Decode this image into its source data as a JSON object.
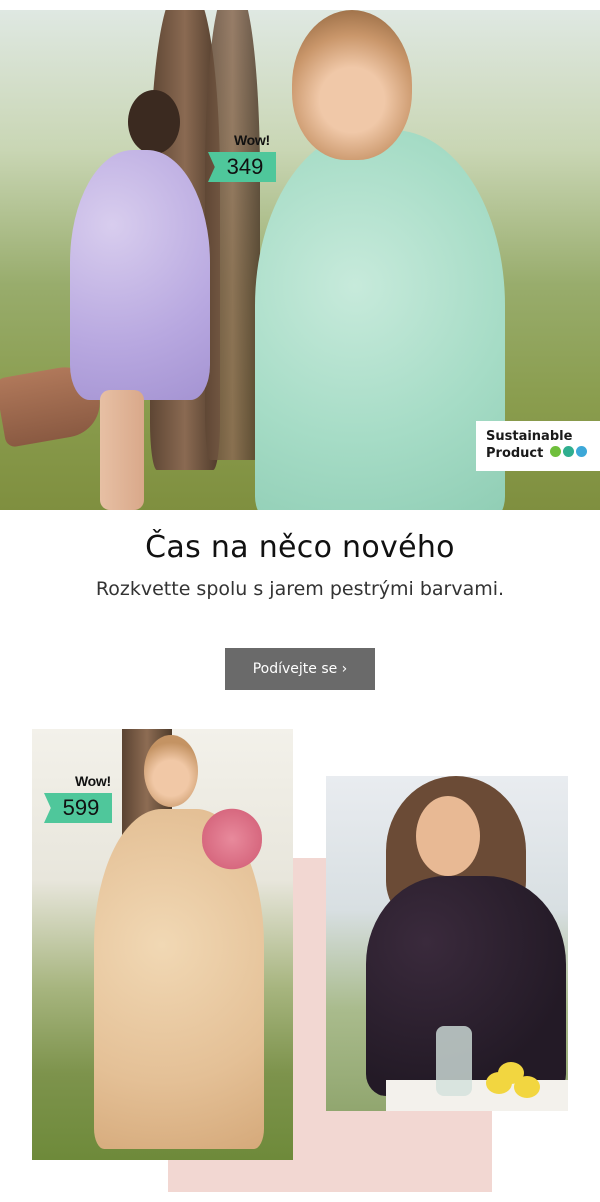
{
  "hero": {
    "badge": {
      "wow": "Wow!",
      "price": "349"
    },
    "sustainable": {
      "line1": "Sustainable",
      "line2": "Product",
      "dot_colors": [
        "#6fbf3b",
        "#2fae8f",
        "#3da8d8"
      ]
    }
  },
  "headline": "Čas na něco nového",
  "subline": "Rozkvette spolu s jarem pestrými barvami.",
  "cta": {
    "label": "Podívejte se ›"
  },
  "product_left": {
    "badge": {
      "wow": "Wow!",
      "price": "599"
    }
  },
  "colors": {
    "price_flag": "#4fc79b",
    "cta_bg": "#6a6a6a",
    "pink_block": "#f2d7d2"
  }
}
